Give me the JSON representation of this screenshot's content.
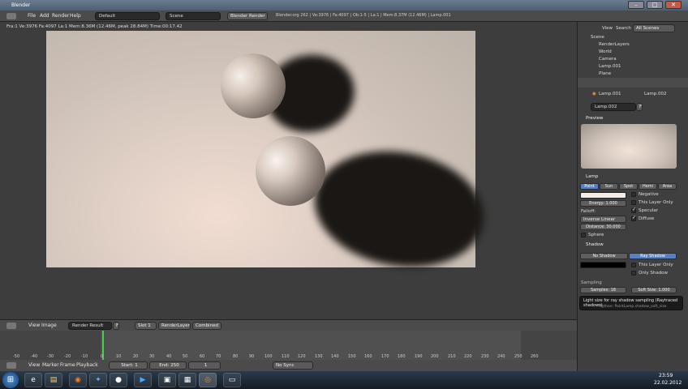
{
  "window": {
    "title": "Blender",
    "controls": [
      "–",
      "□",
      "✕"
    ]
  },
  "menubar": {
    "items": [
      "File",
      "Add",
      "Render",
      "Help"
    ],
    "layout": "Default",
    "scene": "Scene",
    "engine": "Blender Render",
    "info": "Blender.org 262 | Ve:3976 | Fa:4097 | Ob:1-5 | La:1 | Mem:8.37M (12.46M) | Lamp.001"
  },
  "viewport": {
    "stats": "Fra:1  Ve:3976 Fa:4097 La:1 Mem:8.36M (12.46M, peak 28.84M) Time:00:17.42"
  },
  "image_header": {
    "view": "View",
    "image": "Image",
    "result": "Render Result",
    "f_btn": "F",
    "slot": "Slot 1",
    "layer": "RenderLayer",
    "pass": "Combined"
  },
  "timeline": {
    "ticks": [
      "-50",
      "-40",
      "-30",
      "-20",
      "-10",
      "0",
      "10",
      "20",
      "30",
      "40",
      "50",
      "60",
      "70",
      "80",
      "90",
      "100",
      "110",
      "120",
      "130",
      "140",
      "150",
      "160",
      "170",
      "180",
      "190",
      "200",
      "210",
      "220",
      "230",
      "240",
      "250",
      "260"
    ],
    "menu": [
      "View",
      "Marker",
      "Frame",
      "Playback"
    ],
    "start": "Start: 1",
    "end": "End: 250",
    "current": "1",
    "sync": "No Sync"
  },
  "outliner": {
    "view": "View",
    "search": "Search",
    "scenes": "All Scenes",
    "items": [
      "Scene",
      "RenderLayers",
      "World",
      "Camera",
      "Lamp.001",
      "Plane"
    ]
  },
  "properties": {
    "path_scene": "Lamp.001",
    "path_obj": "Lamp.002",
    "datablock": "Lamp.002",
    "f_btn": "F",
    "preview_label": "Preview",
    "lamp_label": "Lamp",
    "lamp_types": [
      "Point",
      "Sun",
      "Spot",
      "Hemi",
      "Area"
    ],
    "lamp_active": "Point",
    "energy": "Energy: 1.000",
    "falloff_label": "Falloff:",
    "falloff": "Inverse Linear",
    "distance": "Distance: 30.000",
    "sphere": "Sphere",
    "negative": "Negative",
    "this_layer_only": "This Layer Only",
    "specular": "Specular",
    "diffuse": "Diffuse",
    "shadow_label": "Shadow",
    "no_shadow": "No Shadow",
    "ray_shadow": "Ray Shadow",
    "shadow_this_layer": "This Layer Only",
    "only_shadow": "Only Shadow",
    "sampling_label": "Sampling",
    "samples": "Samples: 18",
    "soft_size": "Soft Size: 1.000",
    "tooltip_title": "Light size for ray shadow sampling (Raytraced shadows)",
    "tooltip_python": "Python: PointLamp.shadow_soft_size"
  },
  "taskbar": {
    "time": "23:59",
    "date": "22.02.2012"
  }
}
